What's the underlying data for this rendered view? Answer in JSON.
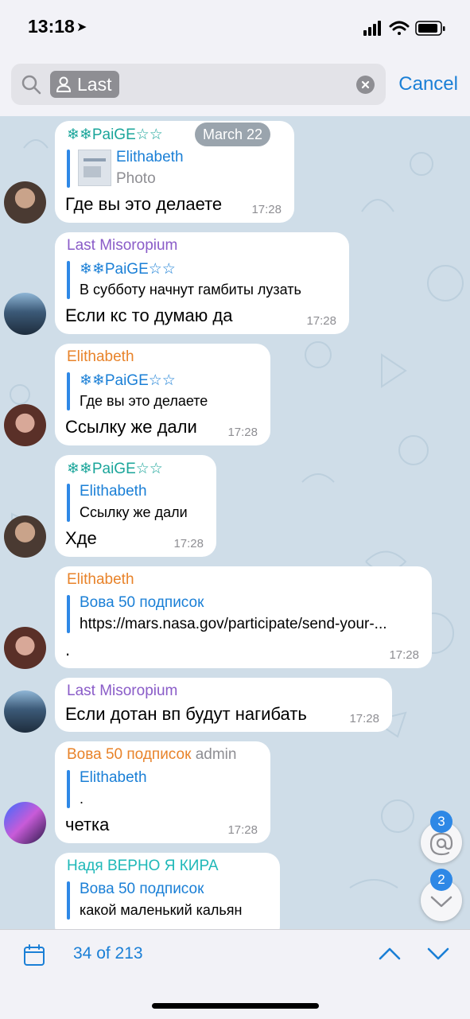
{
  "status": {
    "time": "13:18"
  },
  "search": {
    "chip_label": "Last",
    "cancel": "Cancel"
  },
  "chat": {
    "date_header": "March 22",
    "messages": [
      {
        "sender": "❄❄PaiGE☆☆",
        "reply_to": "Elithabeth",
        "reply_text": "Photo",
        "text": "Где вы это делаете",
        "time": "17:28"
      },
      {
        "sender": "Last Misoropium",
        "reply_to": "❄❄PaiGE☆☆",
        "reply_text": "В субботу начнут гамбиты лузать",
        "text": "Если кс то думаю да",
        "time": "17:28"
      },
      {
        "sender": "Elithabeth",
        "reply_to": "❄❄PaiGE☆☆",
        "reply_text": "Где вы это делаете",
        "text": "Ссылку же дали",
        "time": "17:28"
      },
      {
        "sender": "❄❄PaiGE☆☆",
        "reply_to": "Elithabeth",
        "reply_text": "Ссылку же дали",
        "text": "Хде",
        "time": "17:28"
      },
      {
        "sender": "Elithabeth",
        "reply_to": "Вова 50 подписок",
        "reply_text": "https://mars.nasa.gov/participate/send-your-...",
        "text": ".",
        "time": "17:28"
      },
      {
        "sender": "Last Misoropium",
        "text": "Если дотан вп будут нагибать",
        "time": "17:28"
      },
      {
        "sender": "Вова 50 подписок",
        "role": "admin",
        "reply_to": "Elithabeth",
        "reply_text": ".",
        "text": "четка",
        "time": "17:28"
      },
      {
        "sender": "Надя ВЕРНО Я КИРА",
        "reply_to": "Вова 50 подписок",
        "reply_text": "какой маленький кальян"
      }
    ],
    "mentions_badge": "3",
    "scroll_down_badge": "2"
  },
  "bottom": {
    "counter": "34 of 213"
  },
  "colors": {
    "accent": "#1a7fd6",
    "paige": "#1aa59a",
    "misoropium": "#8a5cc8",
    "elithabeth": "#e8832a",
    "vova": "#e8832a",
    "nadya": "#1fb8b8",
    "chat_bg": "#cfdde8"
  }
}
